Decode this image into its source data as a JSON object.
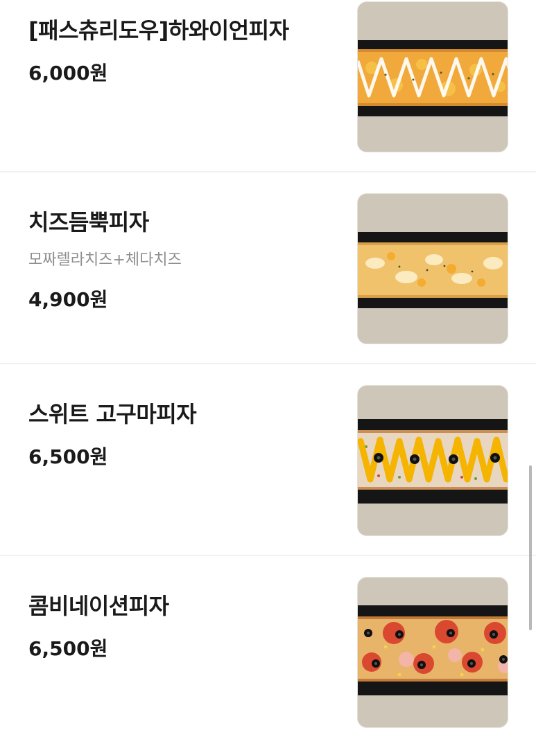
{
  "menu": {
    "items": [
      {
        "name": "[패스츄리도우]하와이언피자",
        "description": "",
        "price": "6,000원",
        "image": "hawaiian-pizza-photo",
        "colors": {
          "base": "#f0a93a",
          "topping": "#ffffff",
          "crust": "#d48a2f"
        }
      },
      {
        "name": "치즈듬뿍피자",
        "description": "모짜렐라치즈+체다치즈",
        "price": "4,900원",
        "image": "cheese-pizza-photo",
        "colors": {
          "base": "#f0c26b",
          "topping": "#fff2cf",
          "crust": "#d9a04a"
        }
      },
      {
        "name": "스위트 고구마피자",
        "description": "",
        "price": "6,500원",
        "image": "sweet-potato-pizza-photo",
        "colors": {
          "base": "#e8d6c0",
          "topping": "#f4b400",
          "crust": "#c98e55"
        }
      },
      {
        "name": "콤비네이션피자",
        "description": "",
        "price": "6,500원",
        "image": "combination-pizza-photo",
        "colors": {
          "base": "#e7b46a",
          "topping": "#d9482f",
          "crust": "#c47a3a"
        }
      }
    ]
  }
}
